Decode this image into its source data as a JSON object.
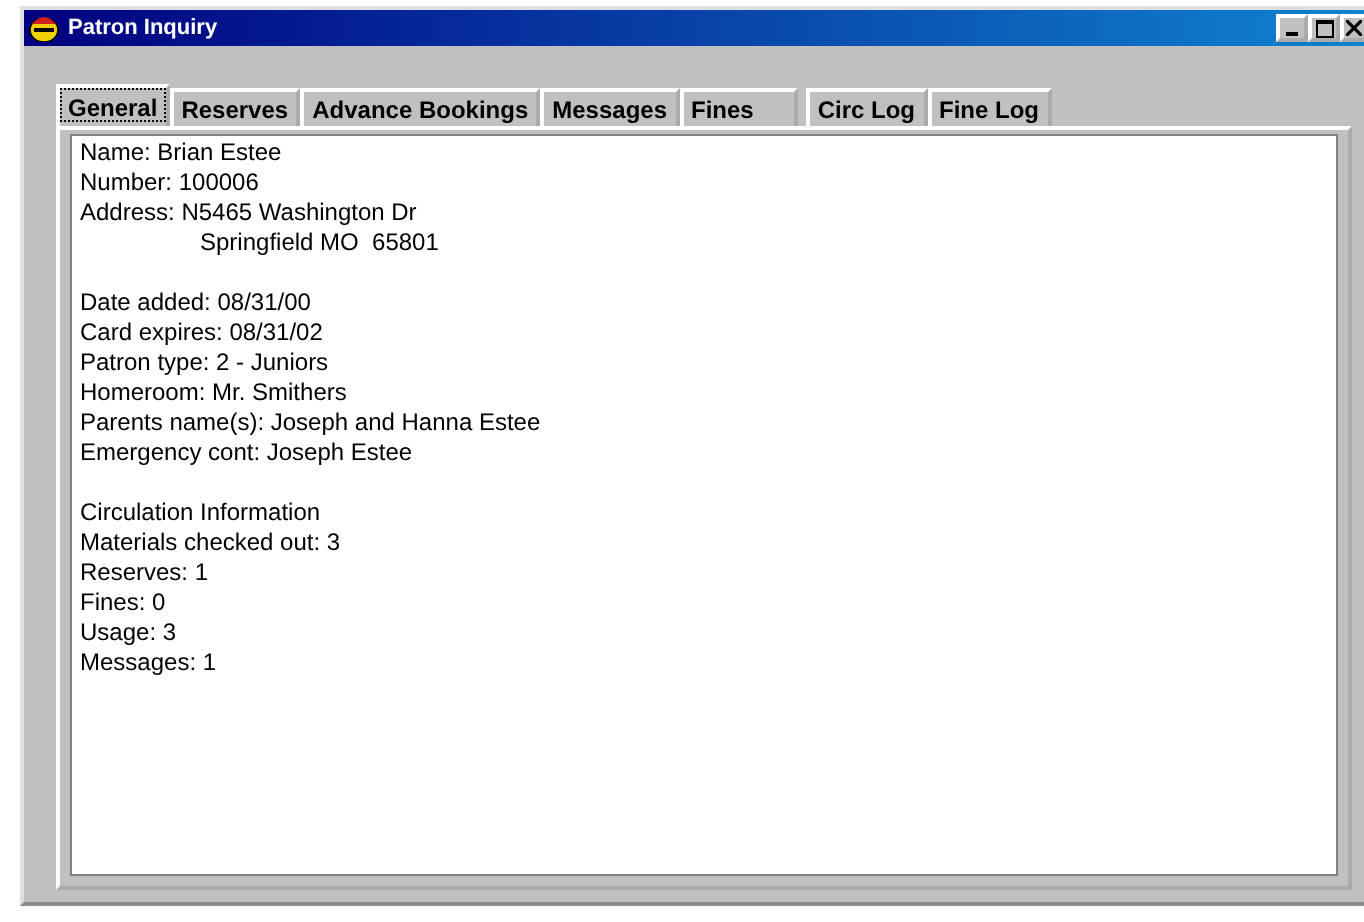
{
  "window": {
    "title": "Patron Inquiry"
  },
  "tabs": [
    {
      "label": "General",
      "selected": true
    },
    {
      "label": "Reserves",
      "selected": false
    },
    {
      "label": "Advance Bookings",
      "selected": false
    },
    {
      "label": "Messages",
      "selected": false
    },
    {
      "label": "Fines",
      "selected": false
    },
    {
      "label": "Circ Log",
      "selected": false
    },
    {
      "label": "Fine Log",
      "selected": false
    }
  ],
  "sections": [
    [
      {
        "text": "Name: Brian Estee",
        "kind": "field"
      },
      {
        "text": "Number: 100006",
        "kind": "field"
      },
      {
        "text": "Address: N5465 Washington Dr",
        "kind": "field"
      },
      {
        "text": "Springfield MO  65801",
        "kind": "continuation"
      }
    ],
    [
      {
        "text": "Date added: 08/31/00",
        "kind": "field"
      },
      {
        "text": "Card expires: 08/31/02",
        "kind": "field"
      },
      {
        "text": "Patron type: 2 - Juniors",
        "kind": "field"
      },
      {
        "text": "Homeroom: Mr. Smithers",
        "kind": "field"
      },
      {
        "text": "Parents name(s): Joseph and Hanna Estee",
        "kind": "field"
      },
      {
        "text": "Emergency cont: Joseph Estee",
        "kind": "field"
      }
    ],
    [
      {
        "text": "Circulation Information",
        "kind": "field"
      },
      {
        "text": "Materials checked out: 3",
        "kind": "field"
      },
      {
        "text": "Reserves: 1",
        "kind": "field"
      },
      {
        "text": "Fines: 0",
        "kind": "field"
      },
      {
        "text": "Usage: 3",
        "kind": "field"
      },
      {
        "text": "Messages: 1",
        "kind": "field"
      }
    ]
  ]
}
